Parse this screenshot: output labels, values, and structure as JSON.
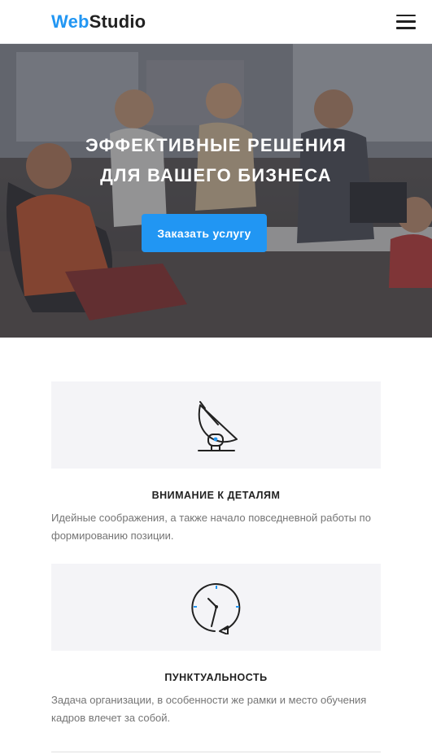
{
  "header": {
    "logo_accent": "Web",
    "logo_rest": "Studio",
    "menu_icon": "hamburger-menu-icon"
  },
  "hero": {
    "title_line1": "Эффективные решения",
    "title_line2": "для вашего бизнеса",
    "cta_label": "Заказать услугу"
  },
  "features": [
    {
      "icon": "satellite-dish-icon",
      "title": "Внимание к деталям",
      "text": "Идейные соображения, а также начало повседневной работы по формированию позиции."
    },
    {
      "icon": "clock-icon",
      "title": "Пунктуальность",
      "text": "Задача организации, в особенности же рамки и место обучения кадров влечет за собой."
    }
  ],
  "colors": {
    "accent": "#2196f3",
    "text_dark": "#212121",
    "text_muted": "#757575",
    "card_bg": "#f4f4f7"
  }
}
